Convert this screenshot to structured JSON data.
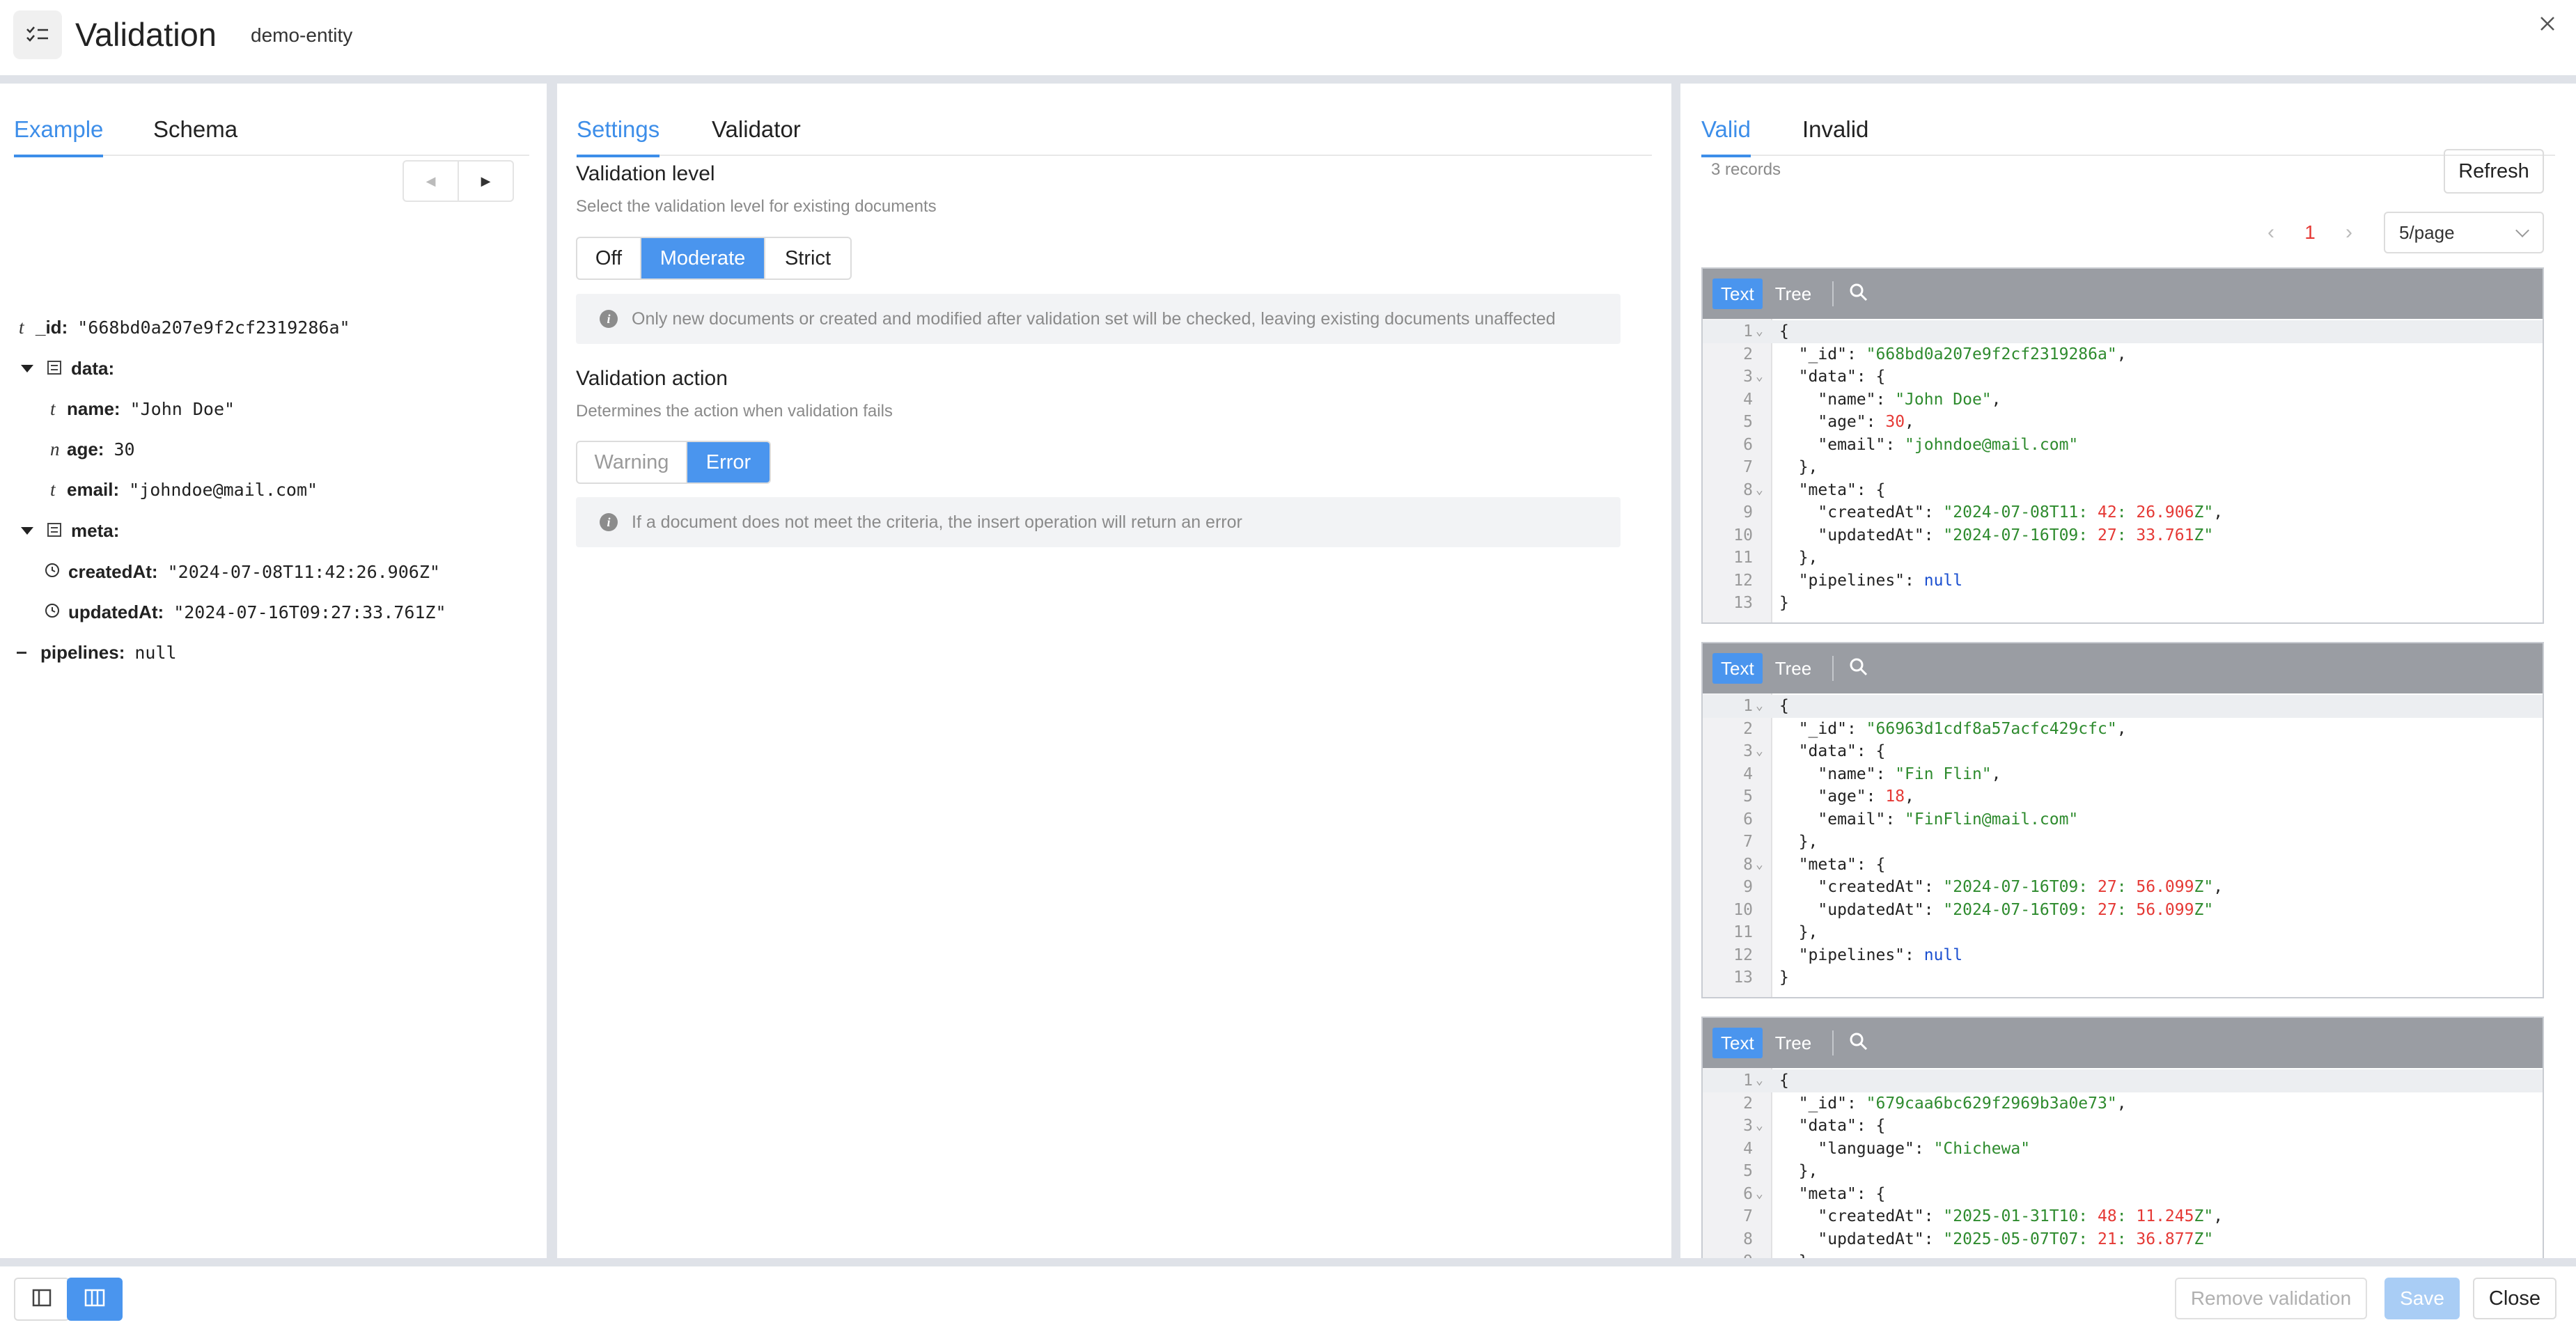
{
  "header": {
    "title": "Validation",
    "entity": "demo-entity"
  },
  "left": {
    "tabs": [
      "Example",
      "Schema"
    ],
    "tree": [
      {
        "type": "t",
        "key": "_id:",
        "value": "\"668bd0a207e9f2cf2319286a\""
      },
      {
        "key": "data:"
      },
      {
        "type": "t",
        "key": "name:",
        "value": "\"John Doe\""
      },
      {
        "type": "n",
        "key": "age:",
        "value": "30"
      },
      {
        "type": "t",
        "key": "email:",
        "value": "\"johndoe@mail.com\""
      },
      {
        "key": "meta:"
      },
      {
        "key": "createdAt:",
        "value": "\"2024-07-08T11:42:26.906Z\""
      },
      {
        "key": "updatedAt:",
        "value": "\"2024-07-16T09:27:33.761Z\""
      },
      {
        "key": "pipelines:",
        "value": "null"
      }
    ]
  },
  "middle": {
    "tabs": [
      "Settings",
      "Validator"
    ],
    "level": {
      "title": "Validation level",
      "hint": "Select the validation level for existing documents",
      "options": [
        "Off",
        "Moderate",
        "Strict"
      ],
      "selected": "Moderate",
      "info": "Only new documents or created and modified after validation set will be checked, leaving existing documents unaffected"
    },
    "action": {
      "title": "Validation action",
      "hint": "Determines the action when validation fails",
      "options": [
        "Warning",
        "Error"
      ],
      "selected": "Error",
      "info": "If a document does not meet the criteria, the insert operation will return an error"
    }
  },
  "right": {
    "tabs": [
      "Valid",
      "Invalid"
    ],
    "records": "3 records",
    "refresh": "Refresh",
    "page": "1",
    "page_size": "5/page",
    "editor_tabs": [
      "Text",
      "Tree"
    ],
    "docs": [
      [
        "{",
        "  \"_id\": \"668bd0a207e9f2cf2319286a\",",
        "  \"data\": {",
        "    \"name\": \"John Doe\",",
        "    \"age\": 30,",
        "    \"email\": \"johndoe@mail.com\"",
        "  },",
        "  \"meta\": {",
        "    \"createdAt\": \"2024-07-08T11:42:26.906Z\",",
        "    \"updatedAt\": \"2024-07-16T09:27:33.761Z\"",
        "  },",
        "  \"pipelines\": null",
        "}"
      ],
      [
        "{",
        "  \"_id\": \"66963d1cdf8a57acfc429cfc\",",
        "  \"data\": {",
        "    \"name\": \"Fin Flin\",",
        "    \"age\": 18,",
        "    \"email\": \"FinFlin@mail.com\"",
        "  },",
        "  \"meta\": {",
        "    \"createdAt\": \"2024-07-16T09:27:56.099Z\",",
        "    \"updatedAt\": \"2024-07-16T09:27:56.099Z\"",
        "  },",
        "  \"pipelines\": null",
        "}"
      ],
      [
        "{",
        "  \"_id\": \"679caa6bc629f2969b3a0e73\",",
        "  \"data\": {",
        "    \"language\": \"Chichewa\"",
        "  },",
        "  \"meta\": {",
        "    \"createdAt\": \"2025-01-31T10:48:11.245Z\",",
        "    \"updatedAt\": \"2025-05-07T07:21:36.877Z\"",
        "  },"
      ]
    ]
  },
  "footer": {
    "remove": "Remove validation",
    "save": "Save",
    "close": "Close"
  },
  "colors": {
    "accent": "#3d8ee9",
    "key": "#222222",
    "string": "#2e8b2e",
    "number": "#e53935",
    "literal": "#1a4fd0"
  }
}
